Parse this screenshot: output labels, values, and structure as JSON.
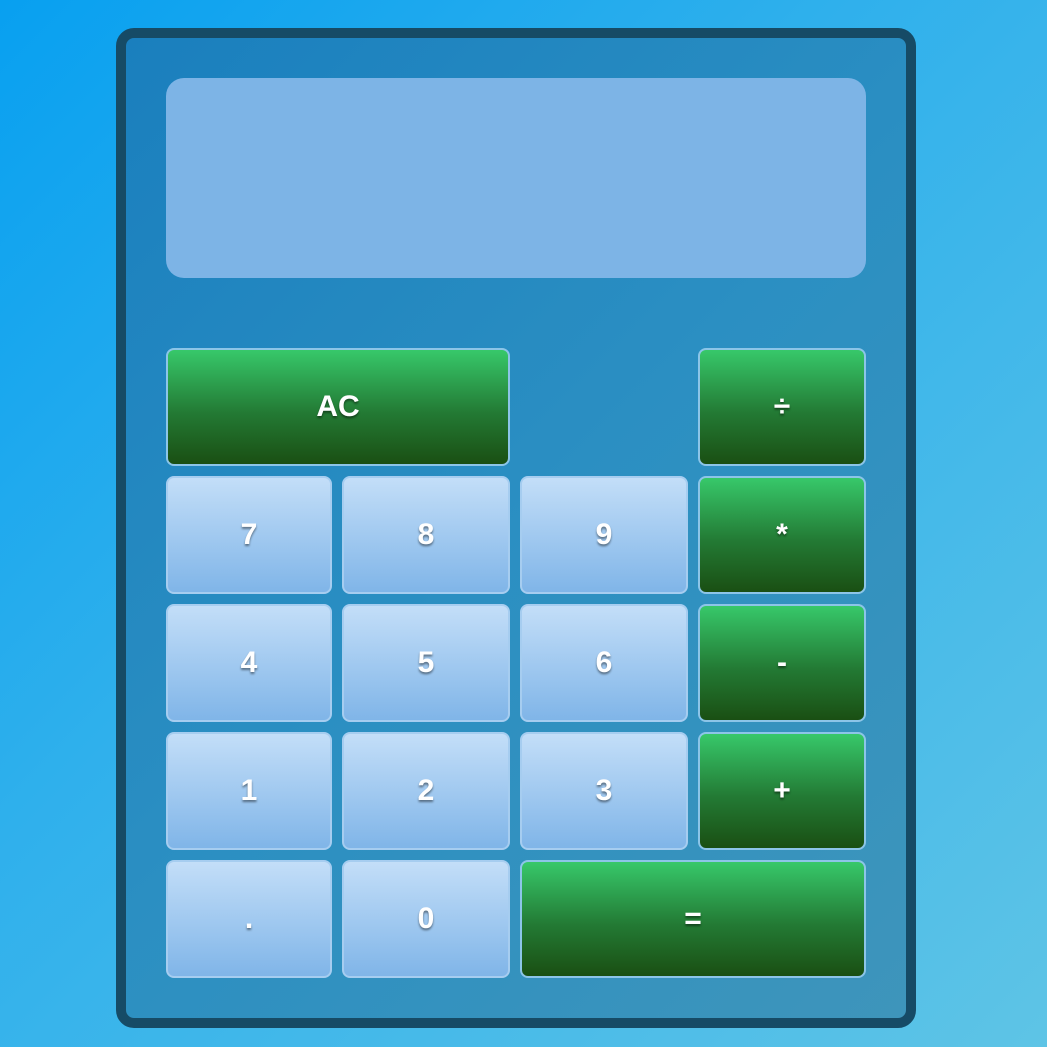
{
  "calculator": {
    "display_value": "",
    "keys": {
      "clear": "AC",
      "divide": "÷",
      "seven": "7",
      "eight": "8",
      "nine": "9",
      "multiply": "*",
      "four": "4",
      "five": "5",
      "six": "6",
      "subtract": "-",
      "one": "1",
      "two": "2",
      "three": "3",
      "add": "+",
      "decimal": ".",
      "zero": "0",
      "equals": "="
    }
  },
  "colors": {
    "page_background": "#08a0f0",
    "frame_border": "#164b66",
    "display_background": "#7db4e6",
    "number_key": "#a2caf0",
    "operator_key": "#237a34"
  }
}
